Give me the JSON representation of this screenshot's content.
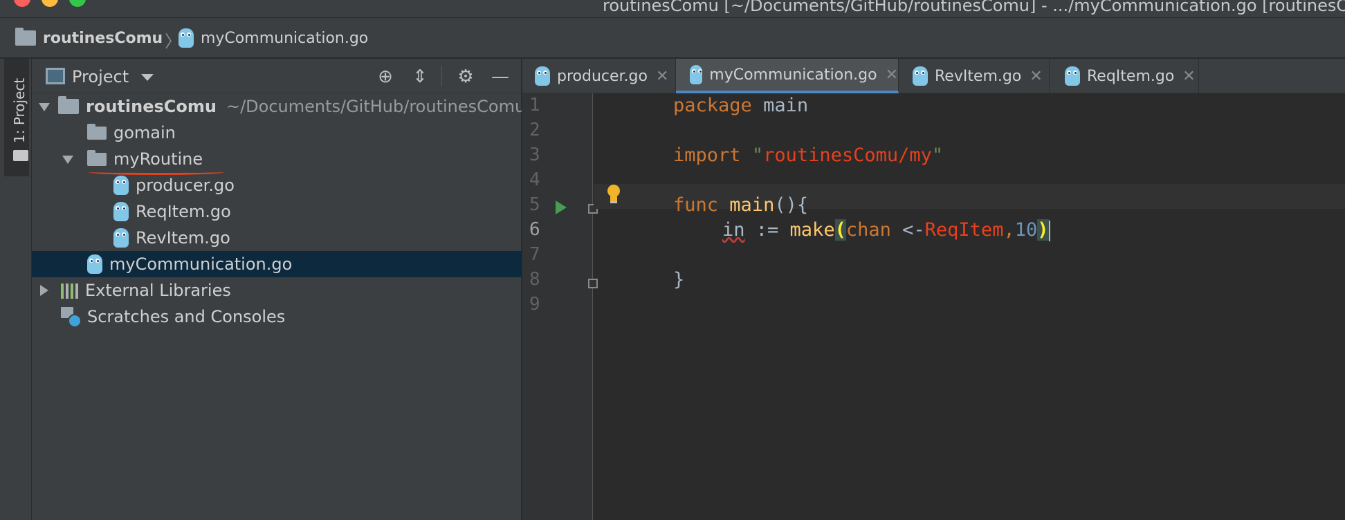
{
  "window": {
    "title": "routinesComu [~/Documents/GitHub/routinesComu] - .../myCommunication.go [routinesComu]"
  },
  "breadcrumb": {
    "project": "routinesComu",
    "file": "myCommunication.go"
  },
  "toolstrip": {
    "project_tab": "1: Project"
  },
  "project_panel": {
    "title": "Project",
    "tree": {
      "root": {
        "name": "routinesComu",
        "path": "~/Documents/GitHub/routinesComu"
      },
      "gomain": "gomain",
      "myRoutine": "myRoutine",
      "producer": "producer.go",
      "reqitem": "ReqItem.go",
      "revitem": "RevItem.go",
      "mycomm": "myCommunication.go",
      "external": "External Libraries",
      "scratches": "Scratches and Consoles"
    }
  },
  "editor": {
    "tabs": [
      {
        "label": "producer.go",
        "active": false
      },
      {
        "label": "myCommunication.go",
        "active": true
      },
      {
        "label": "RevItem.go",
        "active": false
      },
      {
        "label": "ReqItem.go",
        "active": false
      }
    ],
    "line_numbers": [
      "1",
      "2",
      "3",
      "4",
      "5",
      "6",
      "7",
      "8",
      "9"
    ],
    "current_line": 6,
    "code": {
      "l1_kw": "package",
      "l1_name": "main",
      "l3_kw": "import",
      "l3_q1": "\"",
      "l3_path": "routinesComu/my",
      "l3_q2": "\"",
      "l5_kw": "func",
      "l5_name": "main",
      "l5_rest": "(){",
      "l6_ident": "in",
      "l6_op": " := ",
      "l6_fn": "make",
      "l6_paren_open": "(",
      "l6_chan": "chan",
      "l6_arrow": " <-",
      "l6_type": "ReqItem",
      "l6_comma": ",",
      "l6_num": "10",
      "l6_paren_close": ")",
      "l8_brace": "}"
    }
  },
  "colors": {
    "keyword": "#cc7832",
    "function": "#ffc66d",
    "number": "#6897bb",
    "error_red": "#e8401c",
    "active_tab_accent": "#4a88c7",
    "selection": "#0d293e"
  }
}
